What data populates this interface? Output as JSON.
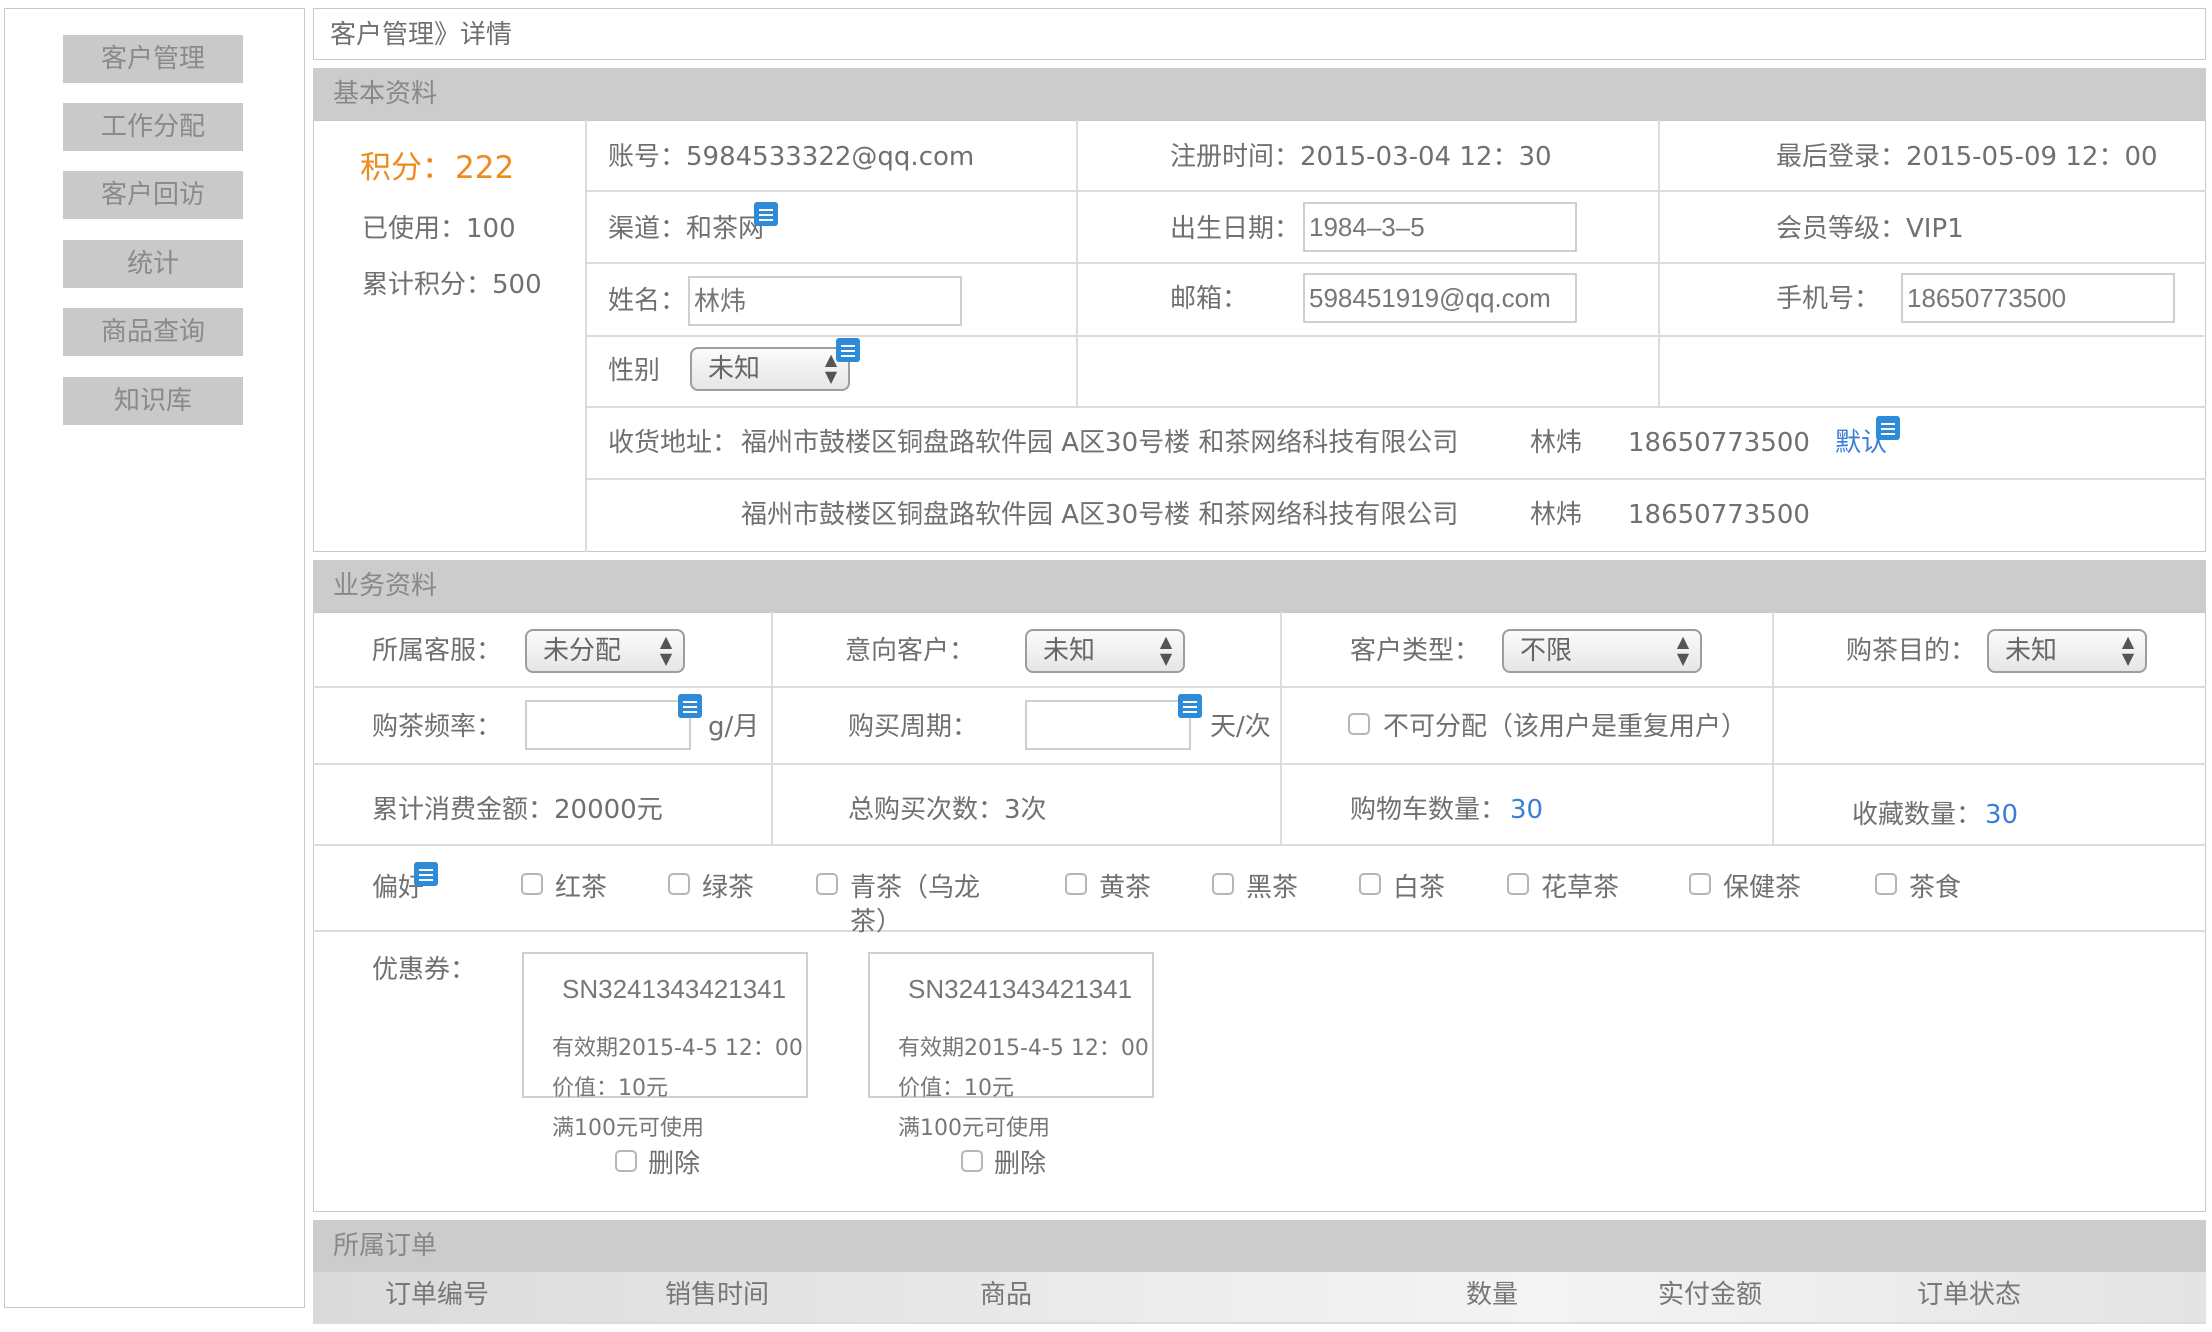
{
  "sidebar": {
    "items": [
      {
        "label": "客户管理"
      },
      {
        "label": "工作分配"
      },
      {
        "label": "客户回访"
      },
      {
        "label": "统计"
      },
      {
        "label": "商品查询"
      },
      {
        "label": "知识库"
      }
    ]
  },
  "breadcrumb": "客户管理》详情",
  "basic": {
    "section_title": "基本资料",
    "points_label": "积分：",
    "points_value": "222",
    "used": "已使用：100",
    "total_points": "累计积分：500",
    "account": "账号：5984533322@qq.com",
    "register_time": "注册时间：2015-03-04  12：30",
    "last_login": "最后登录：2015-05-09  12：00",
    "channel": "渠道：和茶网",
    "birth_label": "出生日期：",
    "birth_value": "1984–3–5",
    "member_level": "会员等级：VIP1",
    "name_label": "姓名：",
    "name_value": "林炜",
    "email_label": "邮箱：",
    "email_value": "598451919@qq.com",
    "phone_label": "手机号：",
    "phone_value": "18650773500",
    "gender_label": "性别",
    "gender_value": "未知",
    "address_label": "收货地址：",
    "addresses": [
      {
        "address": "福州市鼓楼区铜盘路软件园 A区30号楼  和茶网络科技有限公司",
        "name": "林炜",
        "phone": "18650773500",
        "tag": "默认"
      },
      {
        "address": "福州市鼓楼区铜盘路软件园 A区30号楼  和茶网络科技有限公司",
        "name": "林炜",
        "phone": "18650773500"
      }
    ]
  },
  "business": {
    "section_title": "业务资料",
    "service_label": "所属客服：",
    "service_value": "未分配",
    "intent_label": "意向客户：",
    "intent_value": "未知",
    "type_label": "客户类型：",
    "type_value": "不限",
    "purpose_label": "购茶目的：",
    "purpose_value": "未知",
    "frequency_label": "购茶频率：",
    "frequency_unit": "g/月",
    "cycle_label": "购买周期：",
    "cycle_unit": "天/次",
    "no_assign_label": "不可分配（该用户是重复用户）",
    "total_spent": "累计消费金额：20000元",
    "total_orders": "总购买次数：3次",
    "cart_label": "购物车数量：",
    "cart_value": "30",
    "fav_label": "收藏数量：",
    "fav_value": "30",
    "pref_label": "偏好",
    "preferences": [
      "红茶",
      "绿茶",
      "青茶（乌龙",
      "茶）",
      "黄茶",
      "黑茶",
      "白茶",
      "花草茶",
      "保健茶",
      "茶食"
    ],
    "coupon_label": "优惠券：",
    "coupons": [
      {
        "code": "SN3241343421341",
        "valid": "有效期2015-4-5 12：00",
        "value": "价值：10元",
        "rule": "满100元可使用",
        "delete": "删除"
      },
      {
        "code": "SN3241343421341",
        "valid": "有效期2015-4-5 12：00",
        "value": "价值：10元",
        "rule": "满100元可使用",
        "delete": "删除"
      }
    ]
  },
  "orders": {
    "section_title": "所属订单",
    "columns": [
      "订单编号",
      "销售时间",
      "商品",
      "数量",
      "实付金额",
      "订单状态"
    ]
  },
  "colors": {
    "accent": "#3a7fd5",
    "points": "#f08a1e",
    "section_bar": "#cccccc",
    "sidebar_button": "#c9c9c9"
  }
}
